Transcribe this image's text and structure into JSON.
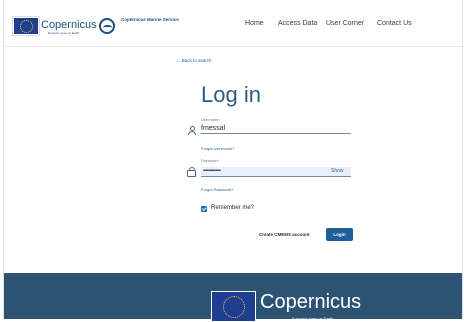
{
  "header": {
    "logo_text": "Copernicus",
    "logo_subtext": "Europe's eyes on Earth",
    "service_name": "Copernicus Marine Service",
    "nav": [
      "Home",
      "Access Data",
      "User Corner",
      "Contact Us"
    ]
  },
  "form": {
    "back_link": "← Back to search",
    "title": "Log in",
    "username_label": "Username",
    "username_value": "fmessal",
    "forgot_username": "Forgot Username?",
    "password_label": "Password",
    "password_value": "••••••••••••••",
    "show_label": "Show",
    "forgot_password": "Forgot Password?",
    "remember_label": "Remember me?",
    "remember_checked": true,
    "create_account": "Create CMEMS account",
    "login_button": "Login"
  },
  "footer": {
    "logo_text": "Copernicus",
    "logo_subtext": "Europe's eyes on Earth"
  },
  "colors": {
    "brand_blue": "#1f5e99",
    "footer_bg": "#2d5374",
    "eu_blue": "#1f3d91",
    "eu_star": "#f4d02e"
  }
}
